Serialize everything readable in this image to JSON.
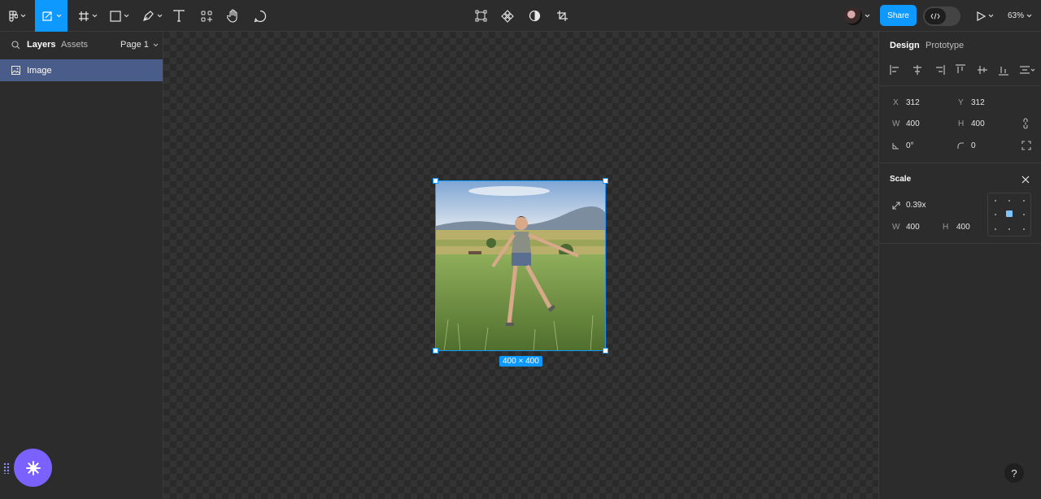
{
  "toolbar": {
    "tools": [
      {
        "name": "figma-menu-icon"
      },
      {
        "name": "move-tool-icon"
      },
      {
        "name": "frame-tool-icon"
      },
      {
        "name": "shape-tool-icon"
      },
      {
        "name": "pen-tool-icon"
      },
      {
        "name": "text-tool-icon"
      },
      {
        "name": "components-tool-icon"
      },
      {
        "name": "hand-tool-icon"
      },
      {
        "name": "comment-tool-icon"
      }
    ],
    "center_tools": [
      "transform-icon",
      "component-icon",
      "contrast-icon",
      "crop-icon"
    ],
    "share_label": "Share",
    "zoom": "63%"
  },
  "left_panel": {
    "tabs": [
      "Layers",
      "Assets"
    ],
    "page": "Page 1",
    "layers": [
      {
        "label": "Image"
      }
    ]
  },
  "canvas": {
    "selection_size": "400 × 400"
  },
  "right_panel": {
    "tabs": [
      "Design",
      "Prototype"
    ],
    "position": {
      "x_label": "X",
      "x": "312",
      "y_label": "Y",
      "y": "312"
    },
    "size": {
      "w_label": "W",
      "w": "400",
      "h_label": "H",
      "h": "400"
    },
    "rotation": "0°",
    "radius": "0",
    "scale": {
      "title": "Scale",
      "factor": "0.39x",
      "w_label": "W",
      "w": "400",
      "h_label": "H",
      "h": "400"
    }
  },
  "help_label": "?",
  "colors": {
    "accent": "#0d99ff",
    "layer_selected": "#4a5d8a",
    "plugin": "#7b61ff"
  }
}
